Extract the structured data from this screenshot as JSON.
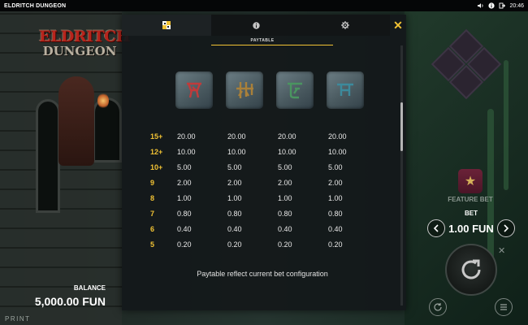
{
  "app": {
    "title": "ELDRITCH DUNGEON",
    "clock": "20:46"
  },
  "logo": {
    "line1": "ELDRITCH",
    "line2": "DUNGEON"
  },
  "paytable": {
    "subtitle": "PAYTABLE",
    "tabs": [
      "paytable-icon",
      "info-icon",
      "settings-icon"
    ],
    "symbols": [
      "rune-eye-icon",
      "rune-claw-icon",
      "rune-hook-icon",
      "rune-gate-icon"
    ],
    "rows": [
      {
        "count": "15+",
        "values": [
          "20.00",
          "20.00",
          "20.00",
          "20.00"
        ]
      },
      {
        "count": "12+",
        "values": [
          "10.00",
          "10.00",
          "10.00",
          "10.00"
        ]
      },
      {
        "count": "10+",
        "values": [
          "5.00",
          "5.00",
          "5.00",
          "5.00"
        ]
      },
      {
        "count": "9",
        "values": [
          "2.00",
          "2.00",
          "2.00",
          "2.00"
        ]
      },
      {
        "count": "8",
        "values": [
          "1.00",
          "1.00",
          "1.00",
          "1.00"
        ]
      },
      {
        "count": "7",
        "values": [
          "0.80",
          "0.80",
          "0.80",
          "0.80"
        ]
      },
      {
        "count": "6",
        "values": [
          "0.40",
          "0.40",
          "0.40",
          "0.40"
        ]
      },
      {
        "count": "5",
        "values": [
          "0.20",
          "0.20",
          "0.20",
          "0.20"
        ]
      }
    ],
    "note": "Paytable reflect current bet configuration",
    "close": "✕"
  },
  "controls": {
    "feature_bet": "FEATURE BET",
    "bet_label": "BET",
    "bet_value": "1.00 FUN",
    "balance_label": "BALANCE",
    "balance_value": "5,000.00 FUN"
  },
  "footer": {
    "print": "PRINT"
  },
  "colors": {
    "accent": "#f1c234",
    "panel": "#14181a"
  }
}
